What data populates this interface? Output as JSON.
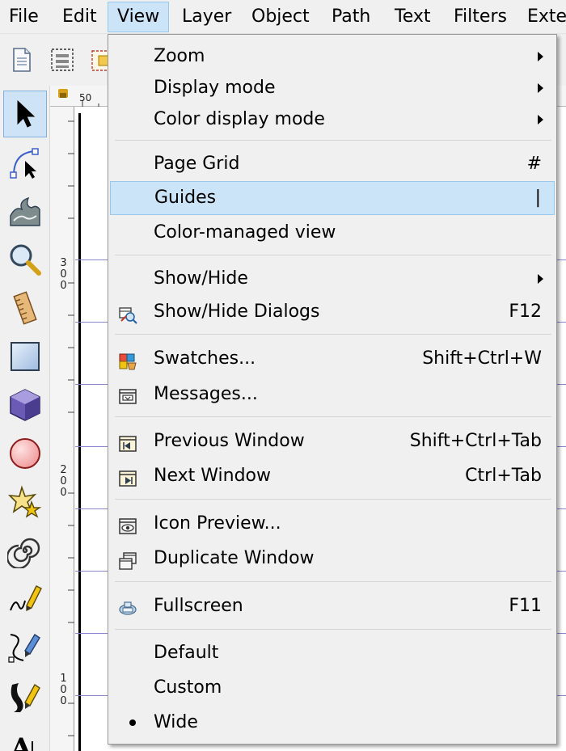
{
  "menubar": {
    "items": [
      {
        "label": "File"
      },
      {
        "label": "Edit"
      },
      {
        "label": "View"
      },
      {
        "label": "Layer"
      },
      {
        "label": "Object"
      },
      {
        "label": "Path"
      },
      {
        "label": "Text"
      },
      {
        "label": "Filters"
      },
      {
        "label": "Exte"
      }
    ],
    "active": "View"
  },
  "rulers": {
    "top_label": "50",
    "left_labels": [
      "300",
      "200",
      "100"
    ]
  },
  "tools": [
    {
      "icon": "selector-arrow-icon",
      "selected": true
    },
    {
      "icon": "node-editor-icon"
    },
    {
      "icon": "tweak-wave-icon"
    },
    {
      "icon": "zoom-magnifier-icon"
    },
    {
      "icon": "measure-ruler-icon"
    },
    {
      "icon": "rectangle-icon"
    },
    {
      "icon": "3d-box-icon"
    },
    {
      "icon": "ellipse-icon"
    },
    {
      "icon": "star-icon"
    },
    {
      "icon": "spiral-icon"
    },
    {
      "icon": "pencil-icon"
    },
    {
      "icon": "pen-bezier-icon"
    },
    {
      "icon": "calligraphy-icon"
    },
    {
      "icon": "text-icon"
    }
  ],
  "view_menu": {
    "zoom": {
      "label": "Zoom"
    },
    "display_mode": {
      "label": "Display mode"
    },
    "color_display_mode": {
      "label": "Color display mode"
    },
    "page_grid": {
      "label": "Page Grid",
      "shortcut": "#"
    },
    "guides": {
      "label": "Guides",
      "shortcut": "|"
    },
    "color_managed_view": {
      "label": "Color-managed view"
    },
    "show_hide": {
      "label": "Show/Hide"
    },
    "show_hide_dialogs": {
      "label": "Show/Hide Dialogs",
      "shortcut": "F12",
      "icon": "show-hide-dialogs-icon"
    },
    "swatches": {
      "label": "Swatches...",
      "shortcut": "Shift+Ctrl+W",
      "icon": "swatches-icon"
    },
    "messages": {
      "label": "Messages...",
      "icon": "messages-icon"
    },
    "previous_window": {
      "label": "Previous Window",
      "shortcut": "Shift+Ctrl+Tab",
      "icon": "previous-window-icon"
    },
    "next_window": {
      "label": "Next Window",
      "shortcut": "Ctrl+Tab",
      "icon": "next-window-icon"
    },
    "icon_preview": {
      "label": "Icon Preview...",
      "icon": "icon-preview-icon"
    },
    "duplicate_window": {
      "label": "Duplicate Window",
      "icon": "duplicate-window-icon"
    },
    "fullscreen": {
      "label": "Fullscreen",
      "shortcut": "F11",
      "icon": "fullscreen-icon"
    },
    "default": {
      "label": "Default"
    },
    "custom": {
      "label": "Custom"
    },
    "wide": {
      "label": "Wide",
      "checked": true
    }
  },
  "colors": {
    "highlight": "#cce4f7",
    "highlight_border": "#99c8ee",
    "menu_bg": "#f0f0f0",
    "guide": "#8a84d0"
  }
}
